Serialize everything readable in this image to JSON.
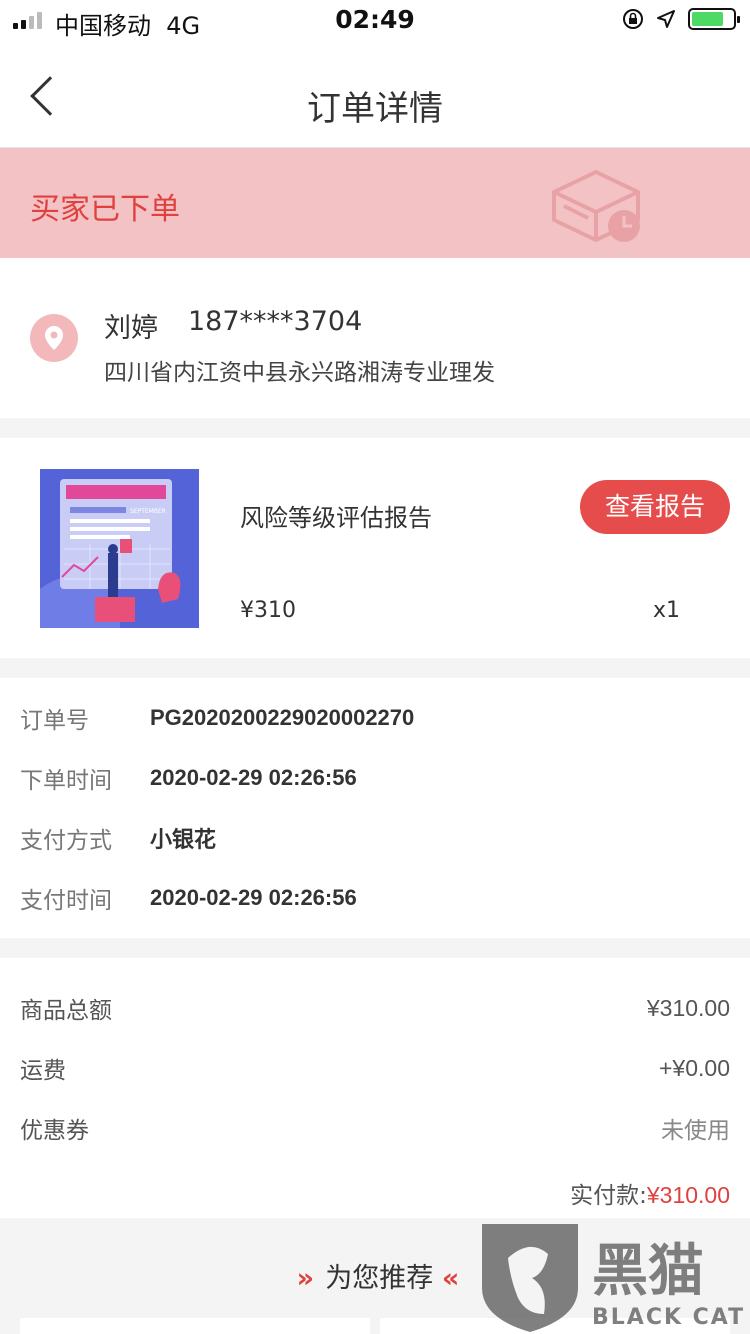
{
  "status_bar": {
    "carrier": "中国移动",
    "network": "4G",
    "time": "02:49"
  },
  "nav": {
    "title": "订单详情"
  },
  "order_status": {
    "text": "买家已下单"
  },
  "address": {
    "name": "刘婷",
    "phone": "187****3704",
    "detail": "四川省内江资中县永兴路湘涛专业理发"
  },
  "product": {
    "name": "风险等级评估报告",
    "price": "¥310",
    "quantity": "x1",
    "report_button": "查看报告",
    "thumbnail_text": "SEPTEMBER"
  },
  "order_info": {
    "rows": [
      {
        "label": "订单号",
        "value": "PG2020200229020002270"
      },
      {
        "label": "下单时间",
        "value": "2020-02-29 02:26:56"
      },
      {
        "label": "支付方式",
        "value": "小银花"
      },
      {
        "label": "支付时间",
        "value": "2020-02-29 02:26:56"
      }
    ]
  },
  "amounts": {
    "rows": [
      {
        "label": "商品总额",
        "value": "¥310.00"
      },
      {
        "label": "运费",
        "value": "+¥0.00"
      },
      {
        "label": "优惠券",
        "value": "未使用"
      }
    ],
    "paid_label": "实付款:",
    "paid_value": "¥310.00"
  },
  "recommend": {
    "title": "为您推荐",
    "left_arrows": "»",
    "right_arrows": "«"
  },
  "watermark": {
    "cn": "黑猫",
    "en": "BLACK CAT"
  },
  "colors": {
    "accent": "#e64c4c",
    "banner": "#f2c2c4",
    "status_text": "#e0413f"
  }
}
